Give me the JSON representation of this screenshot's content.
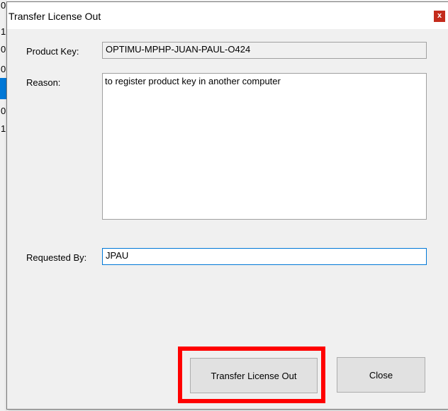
{
  "background": {
    "row_chars": [
      "0",
      "1",
      "0",
      "0",
      "0",
      "1"
    ]
  },
  "dialog": {
    "title": "Transfer License Out",
    "close_glyph": "x",
    "product_key": {
      "label": "Product Key:",
      "value": "OPTIMU-MPHP-JUAN-PAUL-O424"
    },
    "reason": {
      "label": "Reason:",
      "value": "to register product key in another computer"
    },
    "requested_by": {
      "label": "Requested By:",
      "value": "JPAU"
    },
    "buttons": {
      "transfer": "Transfer License Out",
      "close": "Close"
    }
  },
  "annotation": {
    "highlight_color": "#ff0000"
  }
}
